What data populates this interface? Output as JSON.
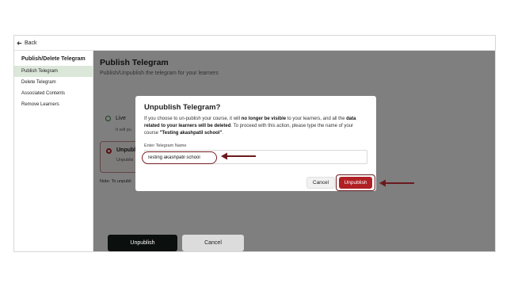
{
  "topbar": {
    "back_label": "Back"
  },
  "sidebar": {
    "title": "Publish/Delete Telegram",
    "items": [
      {
        "label": "Publish Telegram",
        "active": true
      },
      {
        "label": "Delete Telegram"
      },
      {
        "label": "Associated Contents"
      },
      {
        "label": "Remove Learners"
      }
    ]
  },
  "main": {
    "title": "Publish Telegram",
    "subtitle": "Publish/Unpublish the telegram for your learners",
    "options": {
      "live_label": "Live",
      "live_desc": "It will pu",
      "unpublish_label": "Unpubl",
      "unpublish_desc": "Unpublis"
    },
    "note": "Note: To unpubli",
    "footer": {
      "unpublish_label": "Unpublish",
      "cancel_label": "Cancel"
    }
  },
  "modal": {
    "title": "Unpublish Telegram?",
    "body_1": "If you choose to un-publish your course, it will ",
    "body_bold_1": "no longer be visible",
    "body_2": " to your learners, and all the ",
    "body_bold_2": "data related to your learners will be deleted",
    "body_3": ". To proceed with this action, please type the name of your course ",
    "body_bold_3": "\"Testing akashpatil school\"",
    "body_4": ".",
    "field_label": "Enter Telegram Name",
    "field_value": "Testing akashpatil school",
    "cancel_label": "Cancel",
    "unpublish_label": "Unpublish"
  },
  "colors": {
    "accent": "#b01f24",
    "annotation": "#6b1a1e",
    "active_nav": "#dbe7d9"
  }
}
